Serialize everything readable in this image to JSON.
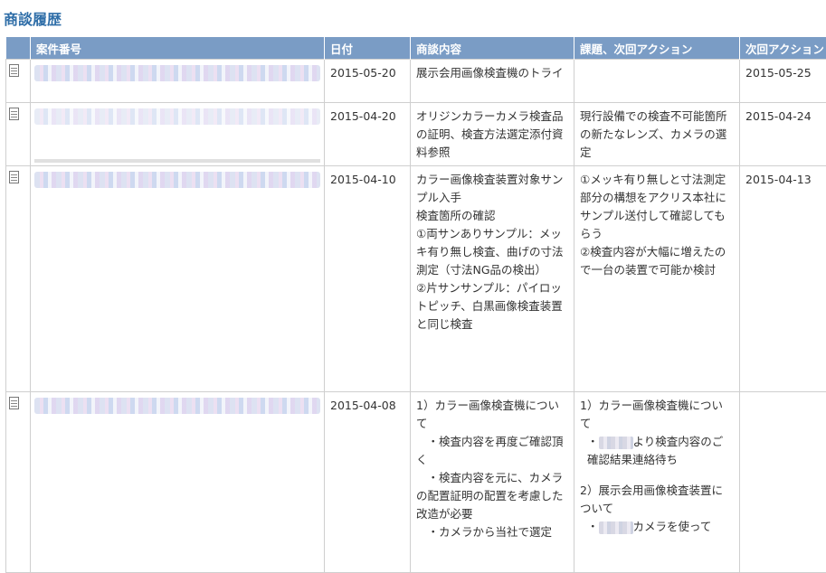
{
  "page": {
    "title": "商談履歴"
  },
  "table": {
    "headers": [
      "",
      "案件番号",
      "日付",
      "商談内容",
      "課題、次回アクション",
      "次回アクション"
    ],
    "rows": [
      {
        "date": "2015-05-20",
        "content": [
          "展示会用画像検査機のトライ"
        ],
        "issues": [],
        "next_date": "2015-05-25"
      },
      {
        "date": "2015-04-20",
        "content": [
          "オリジンカラーカメラ検査品の証明、検査方法選定添付資料参照"
        ],
        "issues": [
          "現行設備での検査不可能箇所の新たなレンズ、カメラの選定"
        ],
        "next_date": "2015-04-24"
      },
      {
        "date": "2015-04-10",
        "content": [
          "カラー画像検査装置対象サンプル入手",
          "検査箇所の確認",
          "①両サンありサンプル：メッキ有り無し検査、曲げの寸法測定（寸法NG品の検出）",
          "②片サンサンプル：パイロットピッチ、白黒画像検査装置と同じ検査"
        ],
        "issues": [
          "①メッキ有り無しと寸法測定部分の構想をアクリス本社にサンプル送付して確認してもらう",
          "②検査内容が大幅に増えたので一台の装置で可能か検討"
        ],
        "next_date": "2015-04-13"
      },
      {
        "date": "2015-04-08",
        "content": [
          "1）カラー画像検査機について",
          "　・検査内容を再度ご確認頂く",
          "　・検査内容を元に、カメラの配置証明の配置を考慮した改造が必要",
          "　・カメラから当社で選定"
        ],
        "issues": [
          "1）カラー画像検査機について",
          "より検査内容のご確認結果連絡待ち",
          "2）展示会用画像検査装置について",
          "カメラを使って"
        ],
        "next_date": ""
      }
    ]
  }
}
